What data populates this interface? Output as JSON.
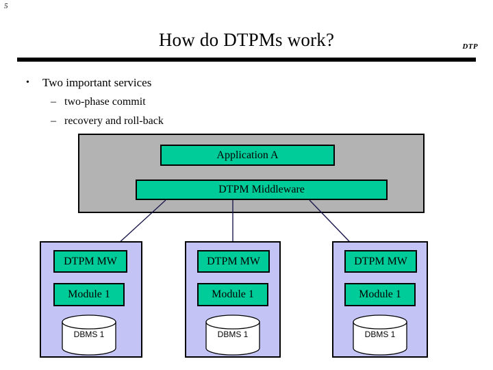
{
  "slide": {
    "number": "5",
    "title": "How do DTPMs work?",
    "corner_logo": "DTP"
  },
  "bullets": [
    {
      "level": 1,
      "marker": "•",
      "text": "Two important services"
    },
    {
      "level": 2,
      "marker": "–",
      "text": "two-phase commit"
    },
    {
      "level": 2,
      "marker": "–",
      "text": "recovery and roll-back"
    }
  ],
  "diagram": {
    "host": {
      "application_label": "Application A",
      "middleware_label": "DTPM Middleware"
    },
    "nodes": [
      {
        "mw_label": "DTPM MW",
        "module_label": "Module 1",
        "dbms_label": "DBMS 1"
      },
      {
        "mw_label": "DTPM MW",
        "module_label": "Module 1",
        "dbms_label": "DBMS 1"
      },
      {
        "mw_label": "DTPM MW",
        "module_label": "Module 1",
        "dbms_label": "DBMS 1"
      }
    ]
  },
  "colors": {
    "green_box": "#00CC99",
    "host_panel_gray": "#B3B3B3",
    "node_panel_lavender": "#C3C3F5",
    "outline": "#000000",
    "background": "#FFFFFF"
  }
}
